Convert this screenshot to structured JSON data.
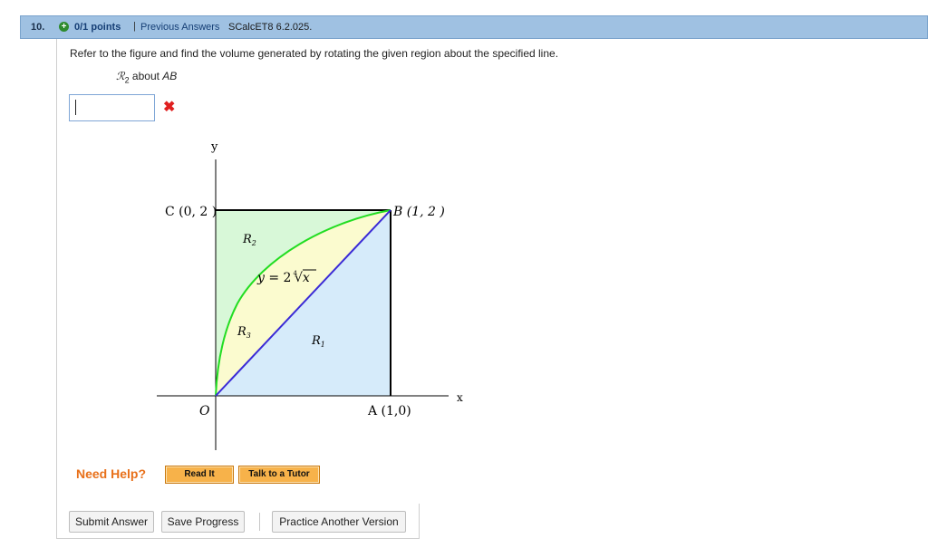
{
  "header": {
    "question_number": "10.",
    "plus_icon": "plus-circle-icon",
    "points": "0/1 points",
    "separator": "|",
    "previous_answers": "Previous Answers",
    "reference": "SCalcET8 6.2.025."
  },
  "question": {
    "prompt": "Refer to the figure and find the volume generated by rotating the given region about the specified line.",
    "region": "ℛ",
    "region_sub": "2",
    "about_text": " about ",
    "axis_line": "AB"
  },
  "answer": {
    "value": "",
    "status_icon": "wrong-x-icon",
    "status_symbol": "✖"
  },
  "figure": {
    "y_label": "y",
    "x_label": "x",
    "point_C": "C (0, 2 )",
    "point_B": "B (1, 2 )",
    "origin": "O",
    "point_A": "A (1,0)",
    "region_R2": "R",
    "region_R2_sub": "2",
    "region_R3": "R",
    "region_R3_sub": "3",
    "region_R1": "R",
    "region_R1_sub": "1",
    "curve_y": "y",
    "curve_eq": " = 2",
    "curve_root_index": "4",
    "curve_root": "√",
    "curve_var": "x",
    "colors": {
      "region_R2": "#d8f8d8",
      "region_R3": "#fbfbcf",
      "region_R1": "#d6ebfa",
      "curve": "#22dd22",
      "diagonal": "#3a2ad6",
      "box": "#000000"
    }
  },
  "help": {
    "label": "Need Help?",
    "read_it": "Read It",
    "talk_tutor": "Talk to a Tutor"
  },
  "actions": {
    "submit": "Submit Answer",
    "save": "Save Progress",
    "practice": "Practice Another Version"
  }
}
